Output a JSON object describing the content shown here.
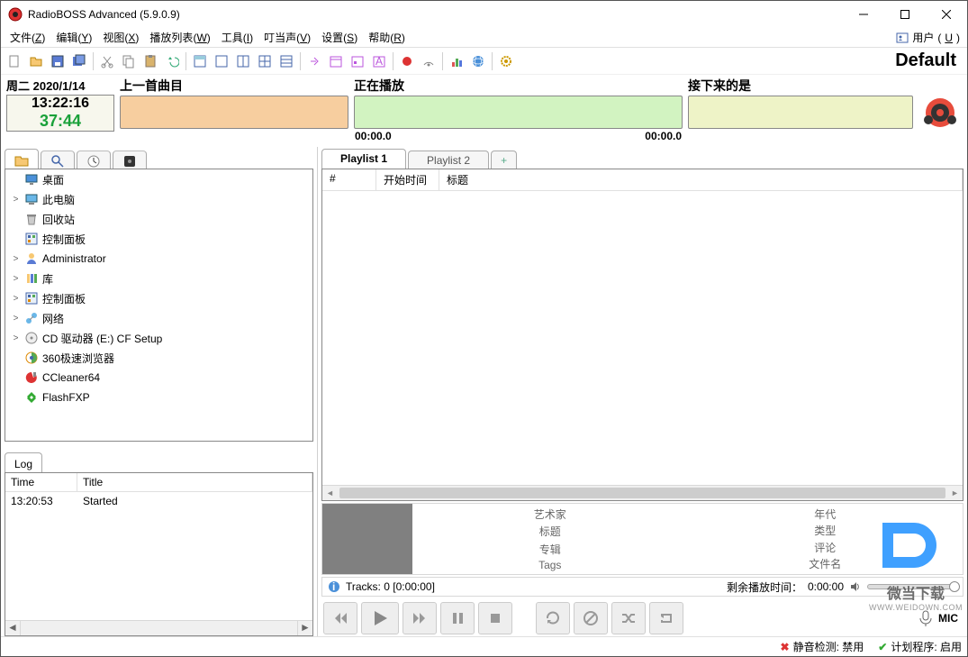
{
  "title": "RadioBOSS Advanced (5.9.0.9)",
  "menus": [
    {
      "label": "文件",
      "key": "Z"
    },
    {
      "label": "编辑",
      "key": "Y"
    },
    {
      "label": "视图",
      "key": "X"
    },
    {
      "label": "播放列表",
      "key": "W"
    },
    {
      "label": "工具",
      "key": "I"
    },
    {
      "label": "叮当声",
      "key": "V"
    },
    {
      "label": "设置",
      "key": "S"
    },
    {
      "label": "帮助",
      "key": "R"
    }
  ],
  "user_menu": {
    "label": "用户",
    "key": "U"
  },
  "profile": "Default",
  "clock": {
    "date": "周二   2020/1/14",
    "time": "13:22:16",
    "countdown": "37:44"
  },
  "prev": {
    "label": "上一首曲目"
  },
  "now": {
    "label": "正在播放",
    "elapsed": "00:00.0",
    "remain": "00:00.0"
  },
  "next": {
    "label": "接下来的是"
  },
  "tree": [
    {
      "exp": "",
      "icon": "desktop",
      "label": "桌面"
    },
    {
      "exp": ">",
      "icon": "pc",
      "label": "此电脑"
    },
    {
      "exp": "",
      "icon": "recycle",
      "label": "回收站"
    },
    {
      "exp": "",
      "icon": "cpl",
      "label": "控制面板"
    },
    {
      "exp": ">",
      "icon": "user",
      "label": "Administrator"
    },
    {
      "exp": ">",
      "icon": "lib",
      "label": "库"
    },
    {
      "exp": ">",
      "icon": "cpl",
      "label": "控制面板"
    },
    {
      "exp": ">",
      "icon": "net",
      "label": "网络"
    },
    {
      "exp": ">",
      "icon": "cd",
      "label": "CD 驱动器 (E:) CF Setup"
    },
    {
      "exp": "",
      "icon": "browser",
      "label": "360极速浏览器"
    },
    {
      "exp": "",
      "icon": "cc",
      "label": "CCleaner64"
    },
    {
      "exp": "",
      "icon": "fxp",
      "label": "FlashFXP"
    }
  ],
  "log": {
    "tab": "Log",
    "headers": {
      "time": "Time",
      "title": "Title"
    },
    "rows": [
      {
        "time": "13:20:53",
        "title": "Started"
      }
    ]
  },
  "playlist": {
    "tabs": [
      "Playlist 1",
      "Playlist 2"
    ],
    "add": "+",
    "headers": {
      "num": "#",
      "start": "开始时间",
      "title": "标题"
    }
  },
  "meta": {
    "left": [
      "艺术家",
      "标题",
      "专辑",
      "Tags"
    ],
    "right": [
      "年代",
      "类型",
      "评论",
      "文件名"
    ]
  },
  "status": {
    "tracks": "Tracks: 0 [0:00:00]",
    "remain_label": "剩余播放时间：",
    "remain": "0:00:00"
  },
  "mic": "MIC",
  "bottom": {
    "mute": "静音检测: 禁用",
    "sched": "计划程序: 启用"
  },
  "watermark": {
    "text": "微当下载",
    "url": "WWW.WEIDOWN.COM"
  }
}
